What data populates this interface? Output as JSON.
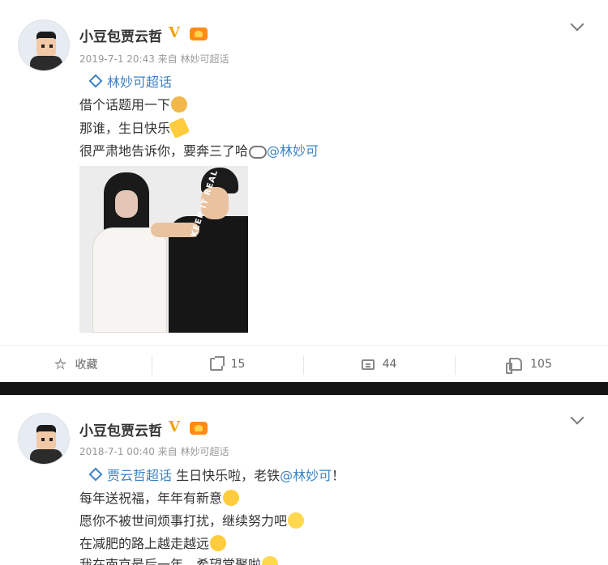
{
  "posts": [
    {
      "username": "小豆包贾云哲",
      "verified_mark": "V",
      "meta": "2019-7-1 20:43 来自 林妙可超话",
      "lines": [
        {
          "tag": "林妙可超话"
        },
        {
          "text": "借个话题用一下"
        },
        {
          "text": "那谁，生日快乐"
        },
        {
          "text": "很严肃地告诉你，要奔三了哈",
          "mention": "@林妙可"
        }
      ],
      "photo_text": "KEEP IT REAL MADNESS",
      "actions": {
        "favorite_label": "收藏",
        "repost_count": "15",
        "comment_count": "44",
        "like_count": "105"
      }
    },
    {
      "username": "小豆包贾云哲",
      "verified_mark": "V",
      "meta": "2018-7-1 00:40 来自 林妙可超话",
      "lines": [
        {
          "tag": "贾云哲超话",
          "text": " 生日快乐啦，老铁",
          "mention": "@林妙可",
          "suffix": "！"
        },
        {
          "text": "每年送祝福，年年有新意"
        },
        {
          "text": "愿你不被世间烦事打扰，继续努力吧"
        },
        {
          "text": "在减肥的路上越走越远"
        },
        {
          "text": "我在南京最后一年，希望常聚啦"
        }
      ]
    }
  ],
  "icons": [
    "avatar",
    "verified-icon",
    "level-badge-icon",
    "chevron-down-icon",
    "super-topic-diamond-icon",
    "star-icon",
    "share-icon",
    "comment-icon",
    "like-icon"
  ],
  "colors": {
    "link": "#3b83c6",
    "verified": "#f1a20d",
    "text": "#333333",
    "meta": "#999999"
  }
}
